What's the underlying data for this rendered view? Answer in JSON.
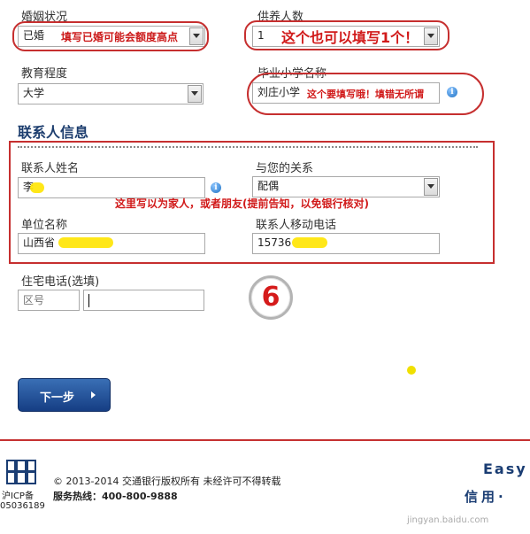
{
  "fields": {
    "marital": {
      "label": "婚姻状况",
      "value": "已婚",
      "note": "填写已婚可能会额度高点"
    },
    "dependents": {
      "label": "供养人数",
      "value": "1",
      "note": "这个也可以填写1个！"
    },
    "education": {
      "label": "教育程度",
      "value": "大学"
    },
    "primary_school": {
      "label": "毕业小学名称",
      "value": "刘庄小学",
      "note": "这个要填写哦！填错无所谓"
    }
  },
  "contact": {
    "section_title": "联系人信息",
    "name": {
      "label": "联系人姓名",
      "value": "李"
    },
    "relation": {
      "label": "与您的关系",
      "value": "配偶"
    },
    "note": "这里写以为家人，或者朋友(提前告知，以免银行核对)",
    "company": {
      "label": "单位名称",
      "value": "山西省"
    },
    "mobile": {
      "label": "联系人移动电话",
      "value": "15736"
    }
  },
  "home_phone": {
    "label": "住宅电话(选填)",
    "area_placeholder": "区号"
  },
  "step_number": "6",
  "next_button": "下一步",
  "footer": {
    "copyright": "© 2013-2014 交通银行版权所有 未经许可不得转载",
    "hotline": "服务热线：400-800-9888",
    "icp1": "沪ICP备",
    "icp2": "05036189",
    "brand_en": "Easy",
    "brand_cn": "信用·",
    "watermark": "jingyan.baidu.com"
  },
  "colors": {
    "accent_red": "#c62f2f",
    "title_blue": "#1c3d6e",
    "button_blue": "#163e84"
  }
}
